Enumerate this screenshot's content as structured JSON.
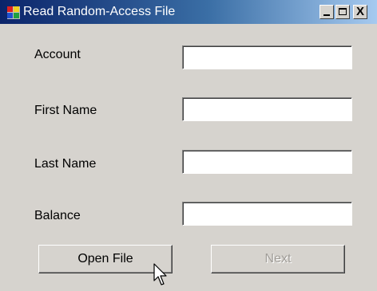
{
  "window": {
    "title": "Read Random-Access File",
    "controls": {
      "minimize": "_",
      "maximize": "□",
      "close": "X"
    },
    "icon": "app-icon"
  },
  "form": {
    "fields": [
      {
        "label": "Account",
        "value": ""
      },
      {
        "label": "First Name",
        "value": ""
      },
      {
        "label": "Last Name",
        "value": ""
      },
      {
        "label": "Balance",
        "value": ""
      }
    ]
  },
  "buttons": {
    "open_file": "Open File",
    "next": "Next"
  },
  "cursor": "arrow-cursor-icon"
}
